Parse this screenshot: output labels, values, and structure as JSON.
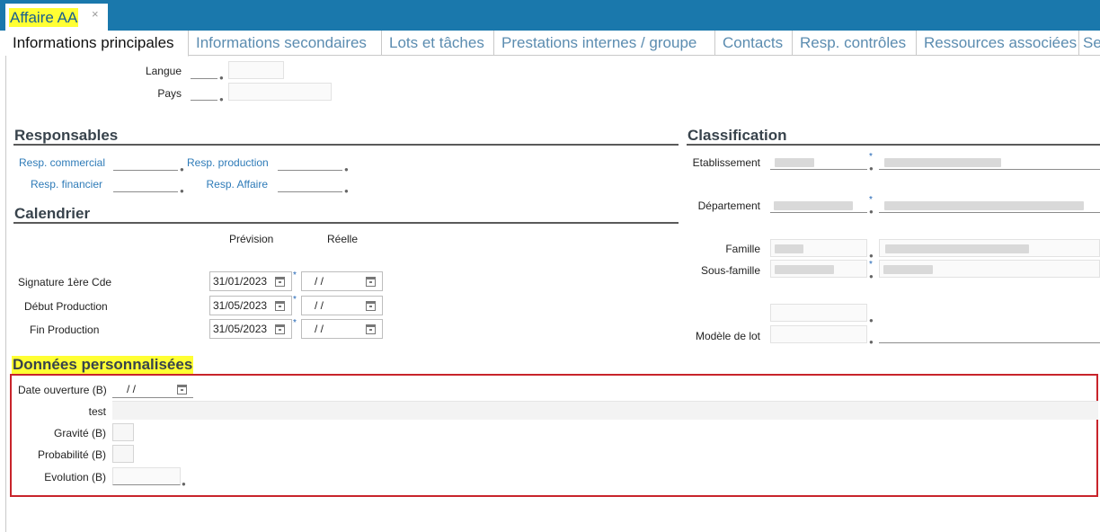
{
  "document_tab": {
    "title": "Affaire AA",
    "close": "×"
  },
  "tabs": [
    "Informations principales",
    "Informations secondaires",
    "Lots et tâches",
    "Prestations internes / groupe",
    "Contacts",
    "Resp. contrôles",
    "Ressources associées",
    "Se"
  ],
  "general": {
    "langue_label": "Langue",
    "pays_label": "Pays"
  },
  "responsables": {
    "title": "Responsables",
    "resp_commercial": "Resp. commercial",
    "resp_production": "Resp. production",
    "resp_financier": "Resp. financier",
    "resp_affaire": "Resp. Affaire"
  },
  "calendrier": {
    "title": "Calendrier",
    "col_prevision": "Prévision",
    "col_reelle": "Réelle",
    "rows": [
      {
        "label": "Signature 1ère Cde",
        "prevision": "31/01/2023",
        "reelle": "/  /"
      },
      {
        "label": "Début Production",
        "prevision": "31/05/2023",
        "reelle": "/  /"
      },
      {
        "label": "Fin Production",
        "prevision": "31/05/2023",
        "reelle": "/  /"
      }
    ],
    "required_mark": "*"
  },
  "classification": {
    "title": "Classification",
    "etablissement": "Etablissement",
    "departement": "Département",
    "famille": "Famille",
    "sous_famille": "Sous-famille",
    "modele_de_lot": "Modèle de lot",
    "required_mark": "*"
  },
  "donnees_perso": {
    "title": "Données personnalisées",
    "date_ouverture_label": "Date ouverture (B)",
    "date_ouverture_value": "/  /",
    "test_label": "test",
    "gravite_label": "Gravité (B)",
    "probabilite_label": "Probabilité (B)",
    "evolution_label": "Evolution (B)"
  },
  "colors": {
    "titlebar": "#1a78ac",
    "highlight": "#ffff33",
    "link": "#2e7bb8",
    "redbox": "#c8242b",
    "required": "#1e63b4"
  },
  "icons": {
    "pin": "location-pin-icon",
    "calendar": "calendar-icon",
    "close": "close-icon"
  }
}
